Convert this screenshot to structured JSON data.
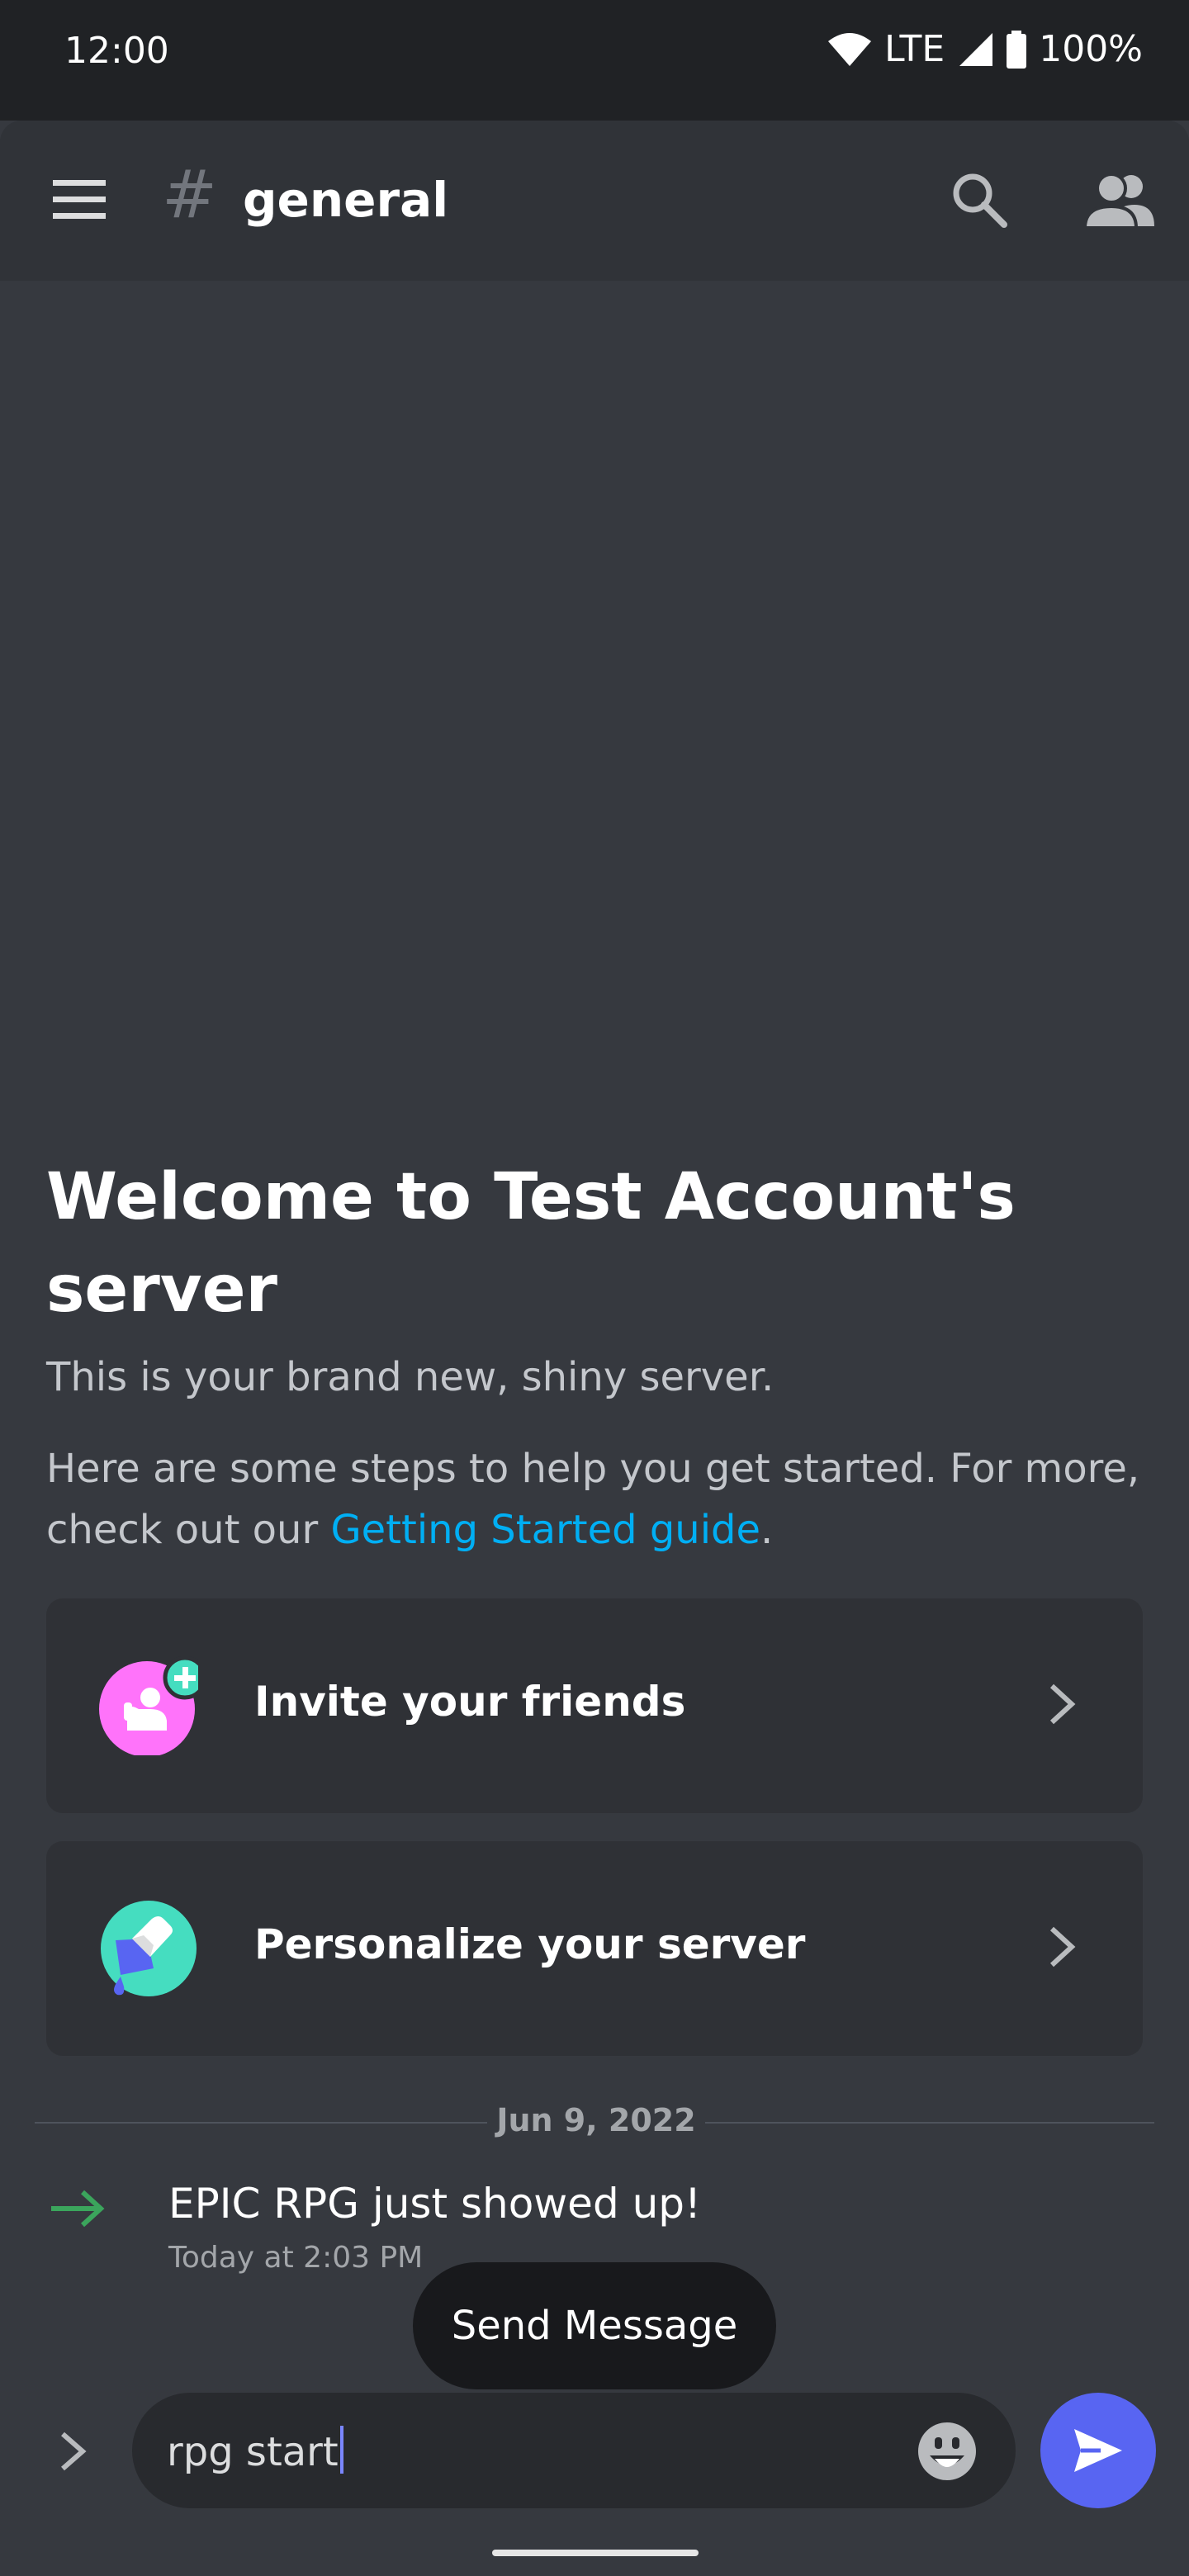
{
  "status_bar": {
    "time": "12:00",
    "network": "LTE",
    "battery": "100%"
  },
  "header": {
    "hash": "#",
    "channel": "general"
  },
  "welcome": {
    "title": "Welcome to Test Account's server",
    "subtitle": "This is your brand new, shiny server.",
    "steps_text": "Here are some steps to help you get started. For more, check out our",
    "steps_link": "Getting Started guide",
    "steps_end": "."
  },
  "cards": [
    {
      "label": "Invite your friends",
      "icon": "invite-friends-icon"
    },
    {
      "label": "Personalize your server",
      "icon": "paintbrush-icon"
    }
  ],
  "divider": {
    "date": "Jun 9, 2022"
  },
  "system_message": {
    "text": "EPIC RPG just showed up!",
    "time": "Today at 2:03 PM"
  },
  "tooltip": {
    "text": "Send Message"
  },
  "composer": {
    "value": "rpg start"
  },
  "colors": {
    "accent": "#5865f2",
    "link": "#00aff4",
    "join_arrow": "#3ba55c",
    "background": "#36393f"
  }
}
